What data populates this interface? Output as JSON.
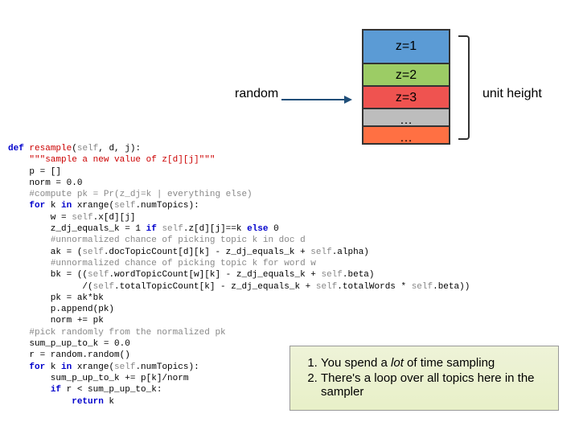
{
  "stack": {
    "z1": "z=1",
    "z2": "z=2",
    "z3": "z=3",
    "z4": "…",
    "z5": "…"
  },
  "random_label": "random",
  "unit_label": "unit height",
  "code": {
    "l01a": "def",
    "l01b": " resample",
    "l01c": "(",
    "l01d": "self",
    "l01e": ", d, j):",
    "l02a": "    ",
    "l02b": "\"\"\"sample a new value of z[d][j]\"\"\"",
    "l03": "    p = []",
    "l04": "    norm = 0.0",
    "l05a": "    ",
    "l05b": "#compute pk = Pr(z_dj=k | everything else)",
    "l06a": "    ",
    "l06b": "for",
    "l06c": " k ",
    "l06d": "in",
    "l06e": " xrange(",
    "l06f": "self",
    "l06g": ".numTopics):",
    "l07a": "        w = ",
    "l07b": "self",
    "l07c": ".x[d][j]",
    "l08a": "        z_dj_equals_k = 1 ",
    "l08b": "if",
    "l08c": " ",
    "l08d": "self",
    "l08e": ".z[d][j]==k ",
    "l08f": "else",
    "l08g": " 0",
    "l09a": "        ",
    "l09b": "#unnormalized chance of picking topic k in doc d",
    "l10a": "        ak = (",
    "l10b": "self",
    "l10c": ".docTopicCount[d][k] - z_dj_equals_k + ",
    "l10d": "self",
    "l10e": ".alpha)",
    "l11a": "        ",
    "l11b": "#unnormalized chance of picking topic k for word w",
    "l12a": "        bk = ((",
    "l12b": "self",
    "l12c": ".wordTopicCount[w][k] - z_dj_equals_k + ",
    "l12d": "self",
    "l12e": ".beta)",
    "l13a": "              /(",
    "l13b": "self",
    "l13c": ".totalTopicCount[k] - z_dj_equals_k + ",
    "l13d": "self",
    "l13e": ".totalWords * ",
    "l13f": "self",
    "l13g": ".beta))",
    "l14": "        pk = ak*bk",
    "l15": "        p.append(pk)",
    "l16": "        norm += pk",
    "l17a": "    ",
    "l17b": "#pick randomly from the normalized pk",
    "l18": "    sum_p_up_to_k = 0.0",
    "l19": "    r = random.random()",
    "l20a": "    ",
    "l20b": "for",
    "l20c": " k ",
    "l20d": "in",
    "l20e": " xrange(",
    "l20f": "self",
    "l20g": ".numTopics):",
    "l21": "        sum_p_up_to_k += p[k]/norm",
    "l22a": "        ",
    "l22b": "if",
    "l22c": " r < sum_p_up_to_k:",
    "l23a": "            ",
    "l23b": "return",
    "l23c": " k"
  },
  "notes": {
    "n1a": "You spend a ",
    "n1b": "lot",
    "n1c": " of time sampling",
    "n2": "There's a loop over all topics here in the sampler"
  }
}
